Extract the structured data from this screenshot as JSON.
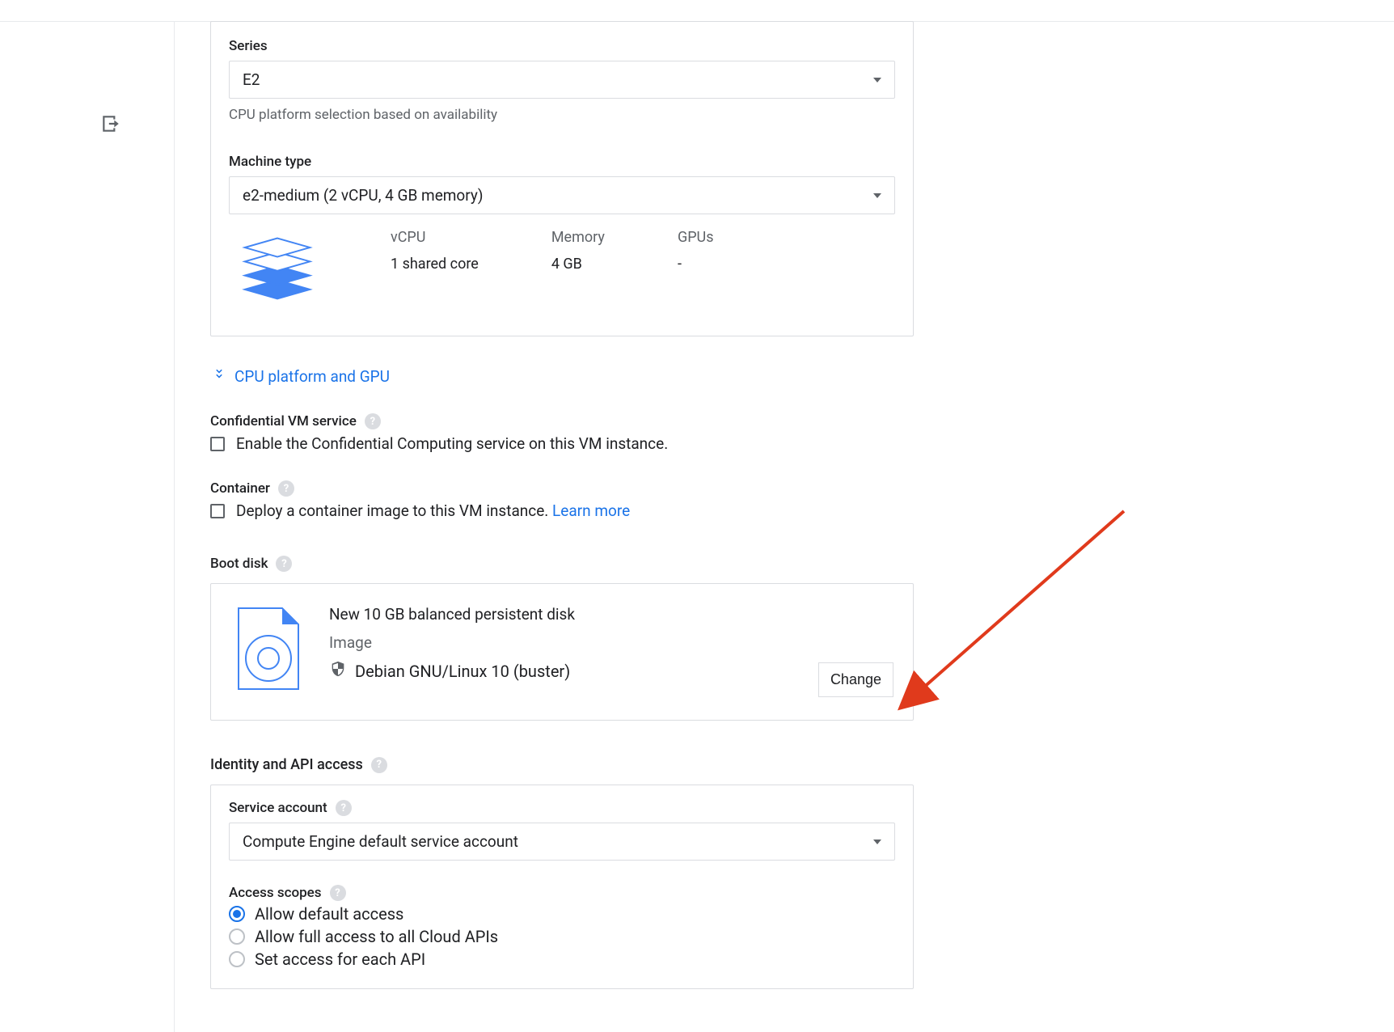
{
  "machine": {
    "series_label": "Series",
    "series_value": "E2",
    "series_hint": "CPU platform selection based on availability",
    "type_label": "Machine type",
    "type_value": "e2-medium (2 vCPU, 4 GB memory)",
    "stats": {
      "vcpu_label": "vCPU",
      "vcpu_value": "1 shared core",
      "memory_label": "Memory",
      "memory_value": "4 GB",
      "gpus_label": "GPUs",
      "gpus_value": "-"
    }
  },
  "cpu_gpu_link": "CPU platform and GPU",
  "confidential": {
    "title": "Confidential VM service",
    "checkbox_label": "Enable the Confidential Computing service on this VM instance."
  },
  "container": {
    "title": "Container",
    "checkbox_label": "Deploy a container image to this VM instance. ",
    "learn_more": "Learn more"
  },
  "boot_disk": {
    "title": "Boot disk",
    "disk_desc": "New 10 GB balanced persistent disk",
    "image_label": "Image",
    "image_name": "Debian GNU/Linux 10 (buster)",
    "change_button": "Change"
  },
  "iaa": {
    "title": "Identity and API access",
    "service_account_label": "Service account",
    "service_account_value": "Compute Engine default service account",
    "access_scopes_label": "Access scopes",
    "scope_options": [
      "Allow default access",
      "Allow full access to all Cloud APIs",
      "Set access for each API"
    ],
    "scope_selected_index": 0
  },
  "help_glyph": "?"
}
